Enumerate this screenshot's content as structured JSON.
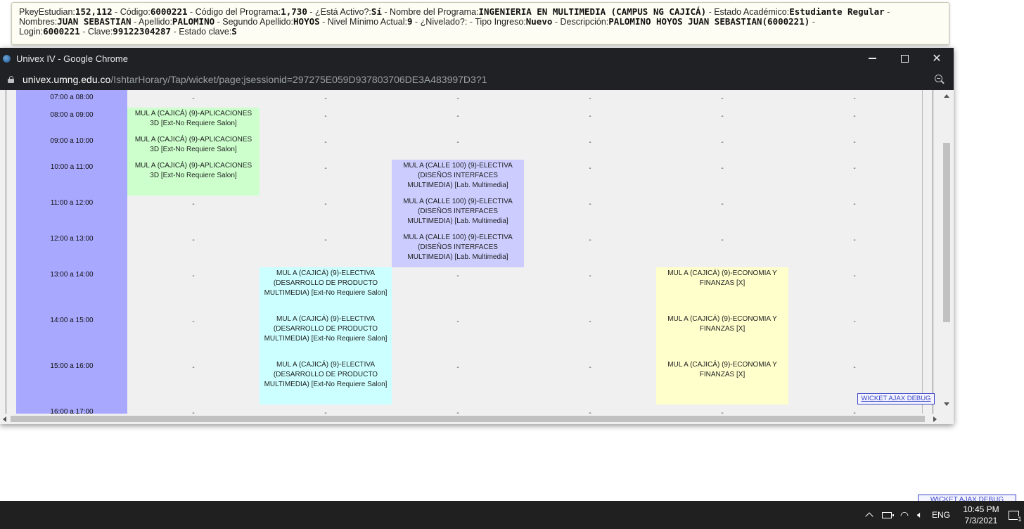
{
  "student_info": {
    "line1": [
      {
        "label": "PkeyEstudian:",
        "value": "152,112"
      },
      {
        "label": "Código:",
        "value": "6000221"
      },
      {
        "label": "Código del Programa:",
        "value": "1,730"
      },
      {
        "label": "¿Está Activo?:",
        "value": "Sí"
      },
      {
        "label": "Nombre del Programa:",
        "value": "INGENIERIA EN MULTIMEDIA (CAMPUS NG CAJICÁ)"
      },
      {
        "label": "Estado Académico:",
        "value": "Estudiante Regular"
      }
    ],
    "line2": [
      {
        "label": "Nombres:",
        "value": "JUAN SEBASTIAN"
      },
      {
        "label": "Apellido:",
        "value": "PALOMINO"
      },
      {
        "label": "Segundo Apellido:",
        "value": "HOYOS"
      },
      {
        "label": "Nivel Mínimo Actual:",
        "value": "9"
      },
      {
        "label": "¿Nivelado?:",
        "value": ""
      },
      {
        "label": "Tipo Ingreso:",
        "value": "Nuevo"
      },
      {
        "label": "Descripción:",
        "value": "PALOMINO HOYOS JUAN SEBASTIAN(6000221)"
      }
    ],
    "line3": [
      {
        "label": "Login:",
        "value": "6000221"
      },
      {
        "label": "Clave:",
        "value": "99122304287"
      },
      {
        "label": "Estado clave:",
        "value": "S"
      }
    ],
    "separator": " - "
  },
  "window": {
    "title": "Univex IV - Google Chrome",
    "url_host": "univex.umng.edu.co",
    "url_path": "/IshtarHorary/Tap/wicket/page;jsessionid=297275E059D937803706DE3A483997D3?1"
  },
  "schedule": {
    "rows": [
      {
        "time": "07:00 a 08:00",
        "cells": [
          "-",
          "-",
          "-",
          "-",
          "-",
          "-"
        ]
      },
      {
        "time": "08:00 a 09:00",
        "cells": [
          "MUL A (CAJICÁ) (9)-APLICACIONES 3D [Ext-No Requiere Salon]",
          "-",
          "-",
          "-",
          "-",
          "-"
        ]
      },
      {
        "time": "09:00 a 10:00",
        "cells": [
          "MUL A (CAJICÁ) (9)-APLICACIONES 3D [Ext-No Requiere Salon]",
          "-",
          "-",
          "-",
          "-",
          "-"
        ]
      },
      {
        "time": "10:00 a 11:00",
        "cells": [
          "MUL A (CAJICÁ) (9)-APLICACIONES 3D [Ext-No Requiere Salon]",
          "-",
          "MUL A (CALLE 100) (9)-ELECTIVA (DISEÑOS INTERFACES MULTIMEDIA) [Lab. Multimedia]",
          "-",
          "-",
          "-"
        ]
      },
      {
        "time": "11:00 a 12:00",
        "cells": [
          "-",
          "-",
          "MUL A (CALLE 100) (9)-ELECTIVA (DISEÑOS INTERFACES MULTIMEDIA) [Lab. Multimedia]",
          "-",
          "-",
          "-"
        ]
      },
      {
        "time": "12:00 a 13:00",
        "cells": [
          "-",
          "-",
          "MUL A (CALLE 100) (9)-ELECTIVA (DISEÑOS INTERFACES MULTIMEDIA) [Lab. Multimedia]",
          "-",
          "-",
          "-"
        ]
      },
      {
        "time": "13:00 a 14:00",
        "cells": [
          "-",
          "MUL A (CAJICÁ) (9)-ELECTIVA (DESARROLLO DE PRODUCTO MULTIMEDIA) [Ext-No Requiere Salon]",
          "-",
          "-",
          "MUL A (CAJICÁ) (9)-ECONOMIA Y FINANZAS [X]",
          "-"
        ]
      },
      {
        "time": "14:00 a 15:00",
        "cells": [
          "-",
          "MUL A (CAJICÁ) (9)-ELECTIVA (DESARROLLO DE PRODUCTO MULTIMEDIA) [Ext-No Requiere Salon]",
          "-",
          "-",
          "MUL A (CAJICÁ) (9)-ECONOMIA Y FINANZAS [X]",
          "-"
        ]
      },
      {
        "time": "15:00 a 16:00",
        "cells": [
          "-",
          "MUL A (CAJICÁ) (9)-ELECTIVA (DESARROLLO DE PRODUCTO MULTIMEDIA) [Ext-No Requiere Salon]",
          "-",
          "-",
          "MUL A (CAJICÁ) (9)-ECONOMIA Y FINANZAS [X]",
          "-"
        ]
      },
      {
        "time": "16:00 a 17:00",
        "cells": [
          "-",
          "-",
          "-",
          "-",
          "-",
          "-"
        ]
      }
    ],
    "colors": {
      "time_column": "#a8a8ff",
      "aplicaciones_3d": "#ccffcc",
      "disenos_interfaces": "#ccccff",
      "desarrollo_producto": "#ccffff",
      "economia_finanzas": "#ffffcc"
    }
  },
  "wicket_debug_label": "WICKET AJAX DEBUG",
  "taskbar": {
    "language": "ENG",
    "time": "10:45 PM",
    "date": "7/3/2021",
    "notification_count": "1"
  }
}
